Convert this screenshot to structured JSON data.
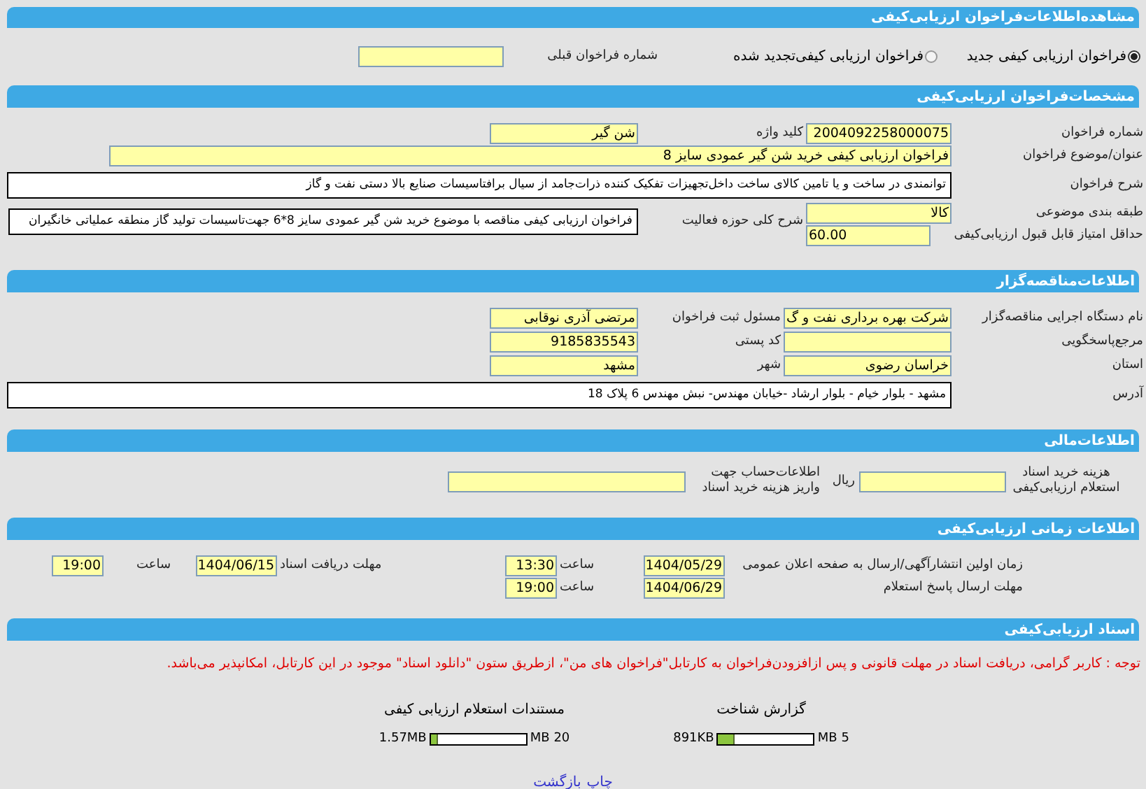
{
  "page_title": "مشاهده‌اطلاعات‌فراخوان ارزیابی‌کیفی",
  "call_type": {
    "options": [
      {
        "label": "فراخوان ارزیابی کیفی جدید",
        "selected": true
      },
      {
        "label": "فراخوان ارزیابی کیفی‌تجدید شده",
        "selected": false
      }
    ],
    "previous_call_label": "شماره فراخوان قبلی"
  },
  "general": {
    "title": "مشخصات‌فراخوان ارزیابی‌کیفی",
    "call_number": {
      "label": "شماره فراخوان",
      "value": "2004092258000075"
    },
    "keyword": {
      "label": "کلید واژه",
      "value": "شن گیر"
    },
    "subject": {
      "label": "عنوان/موضوع فراخوان",
      "value": "فراخوان ارزیابی کیفی خرید شن گیر عمودی سایز 8"
    },
    "description": {
      "label": "شرح فراخوان",
      "value": "توانمندی در ساخت و یا تامین کالای ساخت داخل‌تجهیزات تفکیک کننده ذرات‌جامد از سیال برافتاسیسات صنایع بالا دستی نفت و گاز"
    },
    "category": {
      "label": "طبقه بندی موضوعی",
      "value": "کالا"
    },
    "min_score": {
      "label": "حداقل امتیاز قابل قبول ارزیابی‌کیفی",
      "value": "60.00"
    },
    "scope": {
      "label": "شرح کلی حوزه فعالیت",
      "value": "فراخوان ارزیابی کیفی مناقصه با موضوع خرید شن گیر عمودی سایز 8*6 جهت‌تاسیسات تولید گاز منطقه عملیاتی خانگیران"
    }
  },
  "tenderer": {
    "title": "اطلاعات‌مناقصه‌گزار",
    "organization": {
      "label": "نام دستگاه اجرایی مناقصه‌گزار",
      "value": "شرکت بهره برداری نفت و گ"
    },
    "registrar": {
      "label": "مسئول ثبت فراخوان",
      "value": "مرتضی آذری نوقابی"
    },
    "reference": {
      "label": "مرجع‌پاسخگویی"
    },
    "postal_code": {
      "label": "کد پستی",
      "value": "9185835543"
    },
    "province": {
      "label": "استان",
      "value": "خراسان رضوی"
    },
    "city": {
      "label": "شهر",
      "value": "مشهد"
    },
    "address": {
      "label": "آدرس",
      "value": "مشهد - بلوار خیام - بلوار ارشاد -خیابان مهندس- نبش مهندس 6 پلاک 18"
    }
  },
  "financial": {
    "title": "اطلاعات‌مالی",
    "fee": {
      "label": "هزینه خرید اسناد استعلام ارزیابی‌کیفی",
      "unit": "ریال"
    },
    "account": {
      "label": "اطلاعات‌حساب جهت واریز هزینه خرید اسناد"
    }
  },
  "schedule": {
    "title": "اطلاعات زمانی ارزیابی‌کیفی",
    "publish": {
      "label": "زمان اولین انتشارآگهی/ارسال به صفحه اعلان عمومی",
      "date": "1404/05/29",
      "time_label": "ساعت",
      "time": "13:30"
    },
    "doc_deadline": {
      "label": "مهلت دریافت اسناد",
      "date": "1404/06/15",
      "time_label": "ساعت",
      "time": "19:00"
    },
    "reply_deadline": {
      "label": "مهلت ارسال پاسخ استعلام",
      "date": "1404/06/29",
      "time_label": "ساعت",
      "time": "19:00"
    }
  },
  "documents": {
    "title": "اسناد ارزیابی‌کیفی",
    "notice": "توجه : کاربر گرامی، دریافت اسناد در مهلت قانونی و پس ازافزودن‌فراخوان به کارتابل\"فراخوان های من\"، ازطریق ستون \"دانلود اسناد\" موجود در این کارتابل، امکانپذیر می‌باشد.",
    "files": [
      {
        "name": "گزارش شناخت",
        "size": "891KB",
        "max": "5 MB",
        "level": 0.17
      },
      {
        "name": "مستندات استعلام ارزیابی کیفی",
        "size": "1.57MB",
        "max": "20 MB",
        "level": 0.08
      }
    ]
  },
  "footer_links": [
    "چاپ",
    "بازگشت"
  ]
}
